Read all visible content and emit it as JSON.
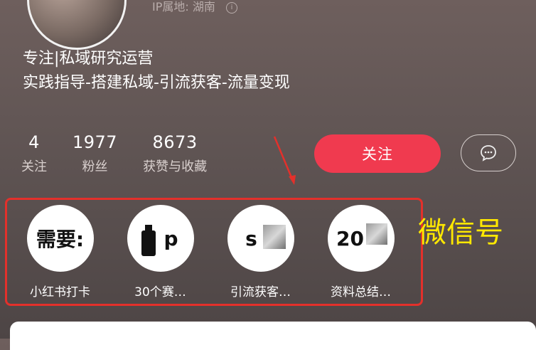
{
  "profile": {
    "ip_location": "IP属地: 湖南",
    "bio_line1": "专注|私域研究运营",
    "bio_line2": "实践指导-搭建私域-引流获客-流量变现"
  },
  "stats": [
    {
      "value": "4",
      "label": "关注"
    },
    {
      "value": "1977",
      "label": "粉丝"
    },
    {
      "value": "8673",
      "label": "获赞与收藏"
    }
  ],
  "actions": {
    "follow_label": "关注"
  },
  "collections": [
    {
      "cover_text": "需要:",
      "label": "小红书打卡"
    },
    {
      "cover_text": "p",
      "label": "30个赛…"
    },
    {
      "cover_text": "s",
      "label": "引流获客…"
    },
    {
      "cover_text": "20",
      "label": "资料总结…"
    }
  ],
  "annotation": {
    "text": "微信号",
    "color": "#ffe800",
    "box_color": "#e3302b"
  },
  "colors": {
    "follow_button": "#f03a4f"
  }
}
